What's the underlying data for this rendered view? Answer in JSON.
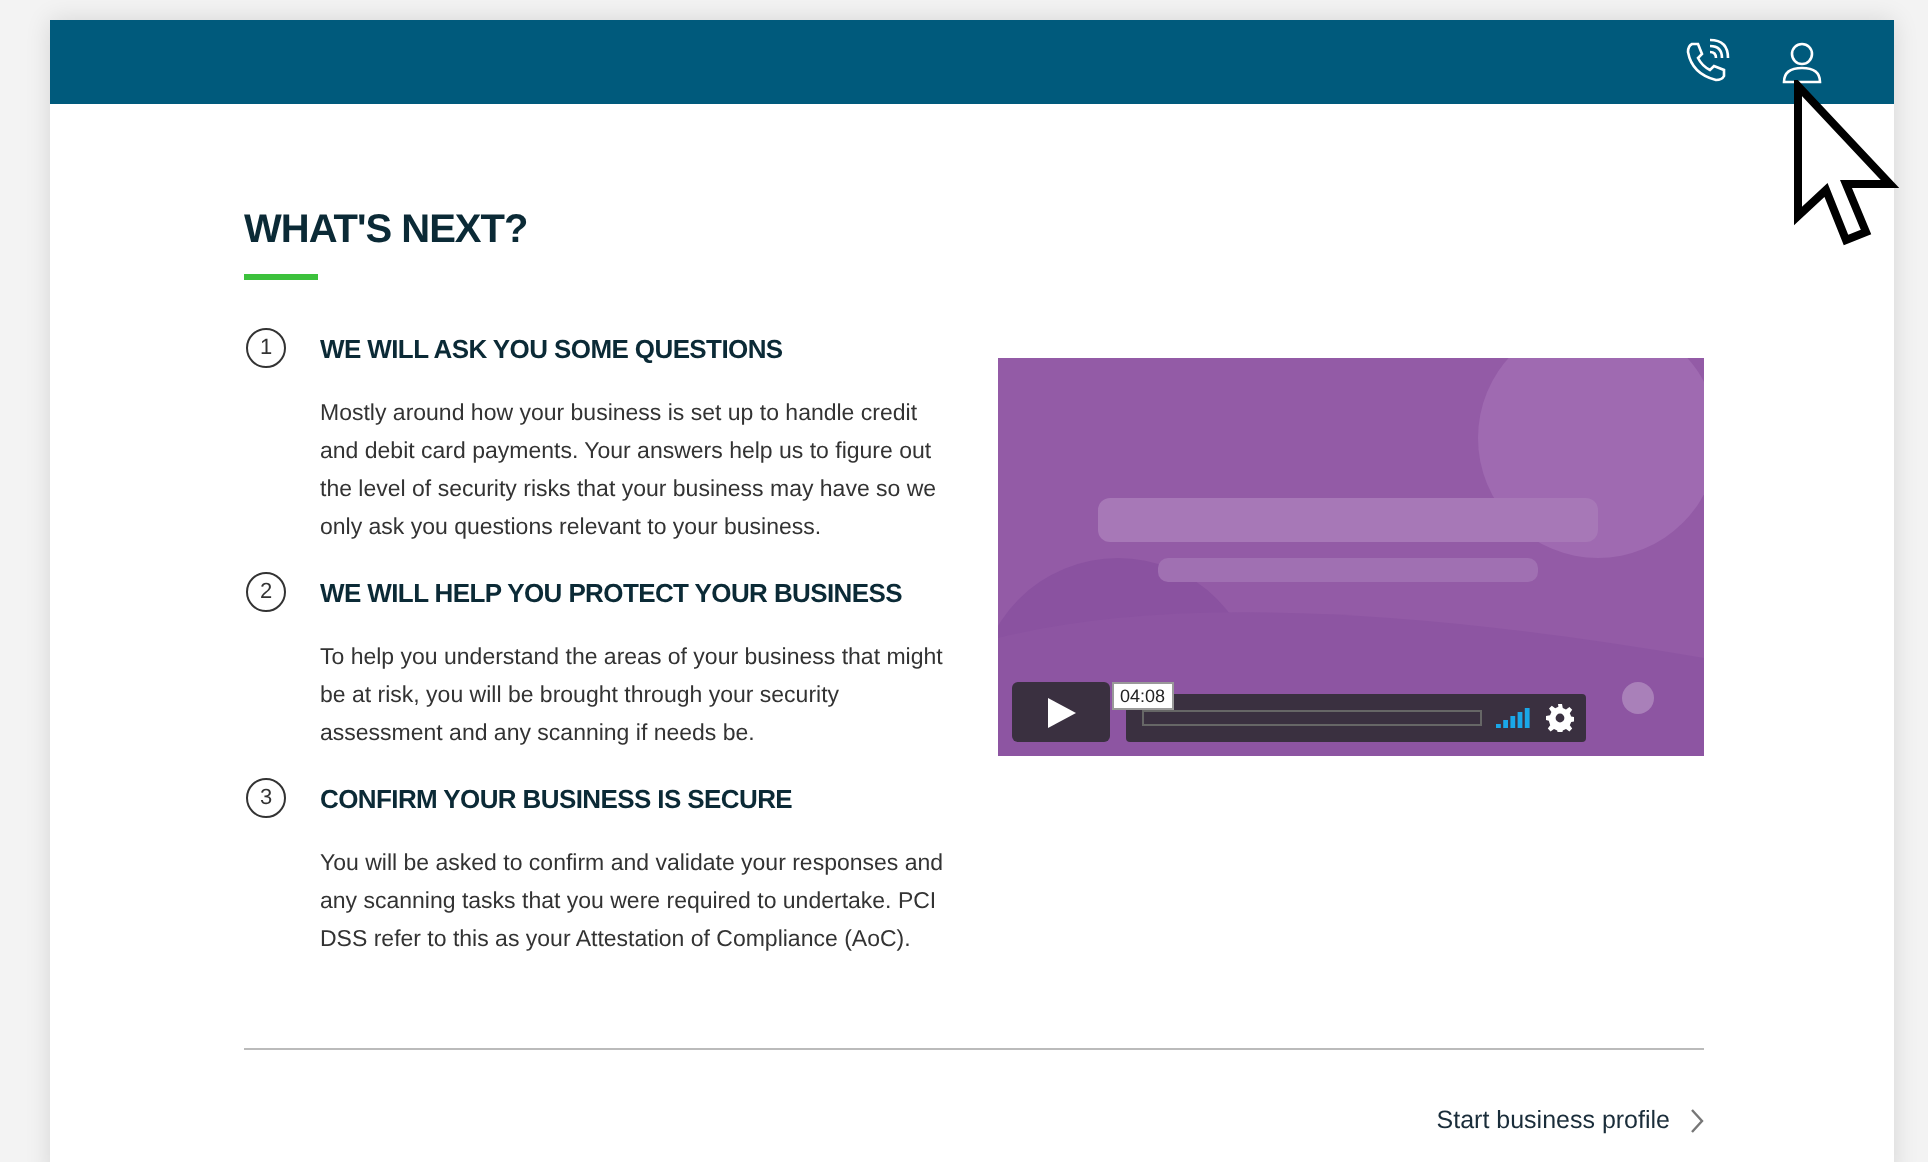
{
  "heading": "WHAT'S NEXT?",
  "steps": [
    {
      "number": "1",
      "title": "WE WILL ASK YOU SOME QUESTIONS",
      "body": "Mostly around how your business is set up to handle credit and debit card payments. Your answers help us to figure out the level of security risks that your business may have so we only ask you questions relevant to your business."
    },
    {
      "number": "2",
      "title": "WE WILL HELP YOU PROTECT YOUR BUSINESS",
      "body": "To help you understand the areas of your business that might be at risk, you will be brought through your security assessment and any scanning if needs be."
    },
    {
      "number": "3",
      "title": "CONFIRM YOUR BUSINESS IS SECURE",
      "body": "You will be asked to confirm and validate your responses and any scanning tasks that you were required to undertake. PCI DSS refer to this as your Attestation of Compliance (AoC)."
    }
  ],
  "video": {
    "kind": "picture",
    "time": "04:08"
  },
  "link": {
    "label": "Start business profile"
  }
}
